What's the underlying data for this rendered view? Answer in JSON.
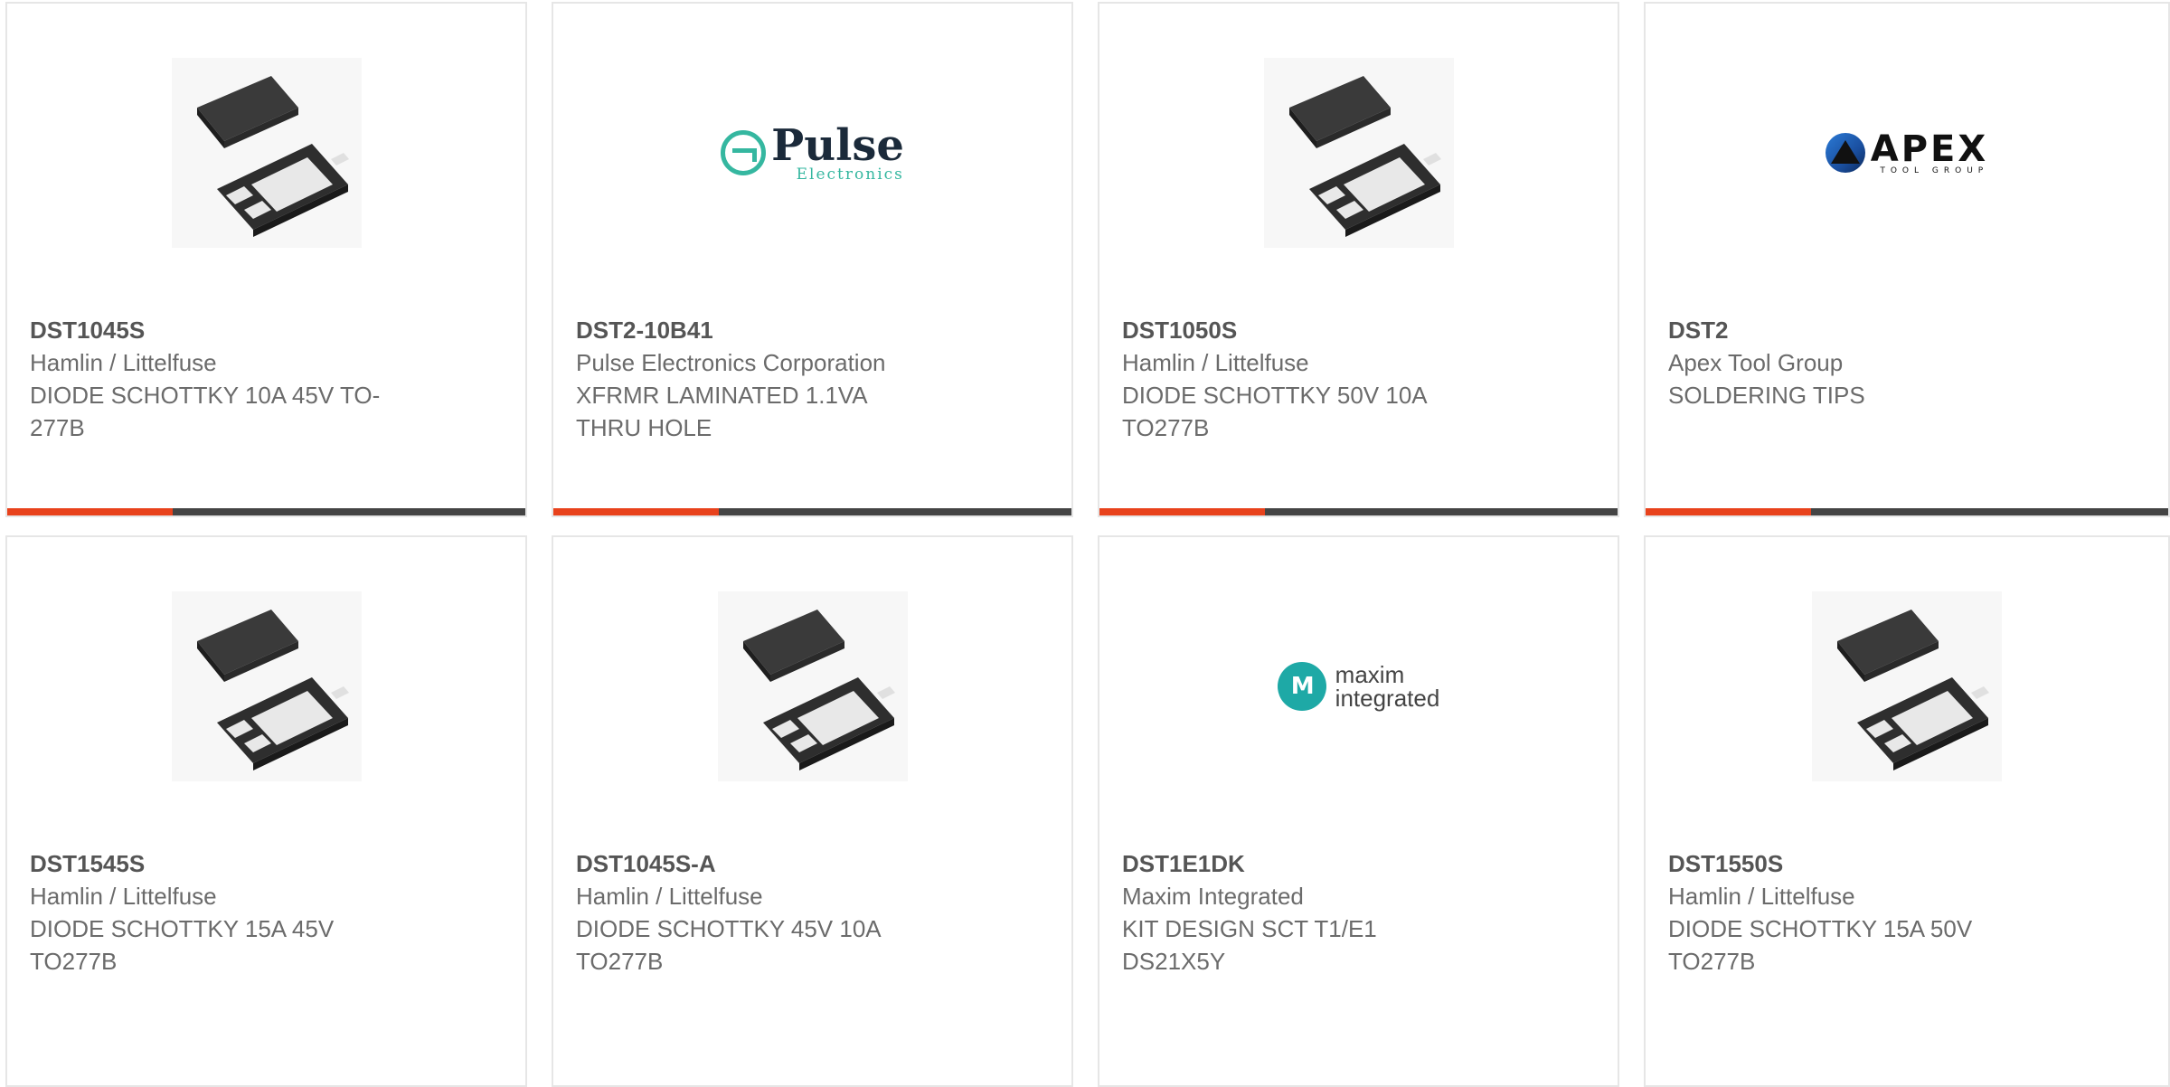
{
  "cards": [
    {
      "part_number": "DST1045S",
      "manufacturer": "Hamlin / Littelfuse",
      "description_line1": "DIODE SCHOTTKY 10A 45V TO-",
      "description_line2": "277B",
      "image": "diode-package-image"
    },
    {
      "part_number": "DST2-10B41",
      "manufacturer": "Pulse Electronics Corporation",
      "description_line1": "XFRMR LAMINATED 1.1VA",
      "description_line2": "THRU HOLE",
      "image": "pulse-electronics-logo",
      "logo_text_big": "Pulse",
      "logo_text_small": "Electronics"
    },
    {
      "part_number": "DST1050S",
      "manufacturer": "Hamlin / Littelfuse",
      "description_line1": "DIODE SCHOTTKY 50V 10A",
      "description_line2": "TO277B",
      "image": "diode-package-image"
    },
    {
      "part_number": "DST2",
      "manufacturer": "Apex Tool Group",
      "description_line1": "SOLDERING TIPS",
      "description_line2": "",
      "image": "apex-tool-group-logo",
      "logo_text_big": "APEX",
      "logo_text_small": "TOOL GROUP"
    },
    {
      "part_number": "DST1545S",
      "manufacturer": "Hamlin / Littelfuse",
      "description_line1": "DIODE SCHOTTKY 15A 45V",
      "description_line2": "TO277B",
      "image": "diode-package-image"
    },
    {
      "part_number": "DST1045S-A",
      "manufacturer": "Hamlin / Littelfuse",
      "description_line1": "DIODE SCHOTTKY 45V 10A",
      "description_line2": "TO277B",
      "image": "diode-package-image"
    },
    {
      "part_number": "DST1E1DK",
      "manufacturer": "Maxim Integrated",
      "description_line1": "KIT DESIGN SCT T1/E1",
      "description_line2": "DS21X5Y",
      "image": "maxim-integrated-logo",
      "logo_text_line1": "maxim",
      "logo_text_line2": "integrated",
      "logo_mark": "M"
    },
    {
      "part_number": "DST1550S",
      "manufacturer": "Hamlin / Littelfuse",
      "description_line1": "DIODE SCHOTTKY 15A 50V",
      "description_line2": "TO277B",
      "image": "diode-package-image"
    }
  ],
  "colors": {
    "accent": "#e8421c",
    "bar": "#444444",
    "border": "#e6e6e6",
    "text": "#6b6b6b",
    "pulse_teal": "#35b7a0",
    "maxim_teal": "#1ea9a6"
  }
}
